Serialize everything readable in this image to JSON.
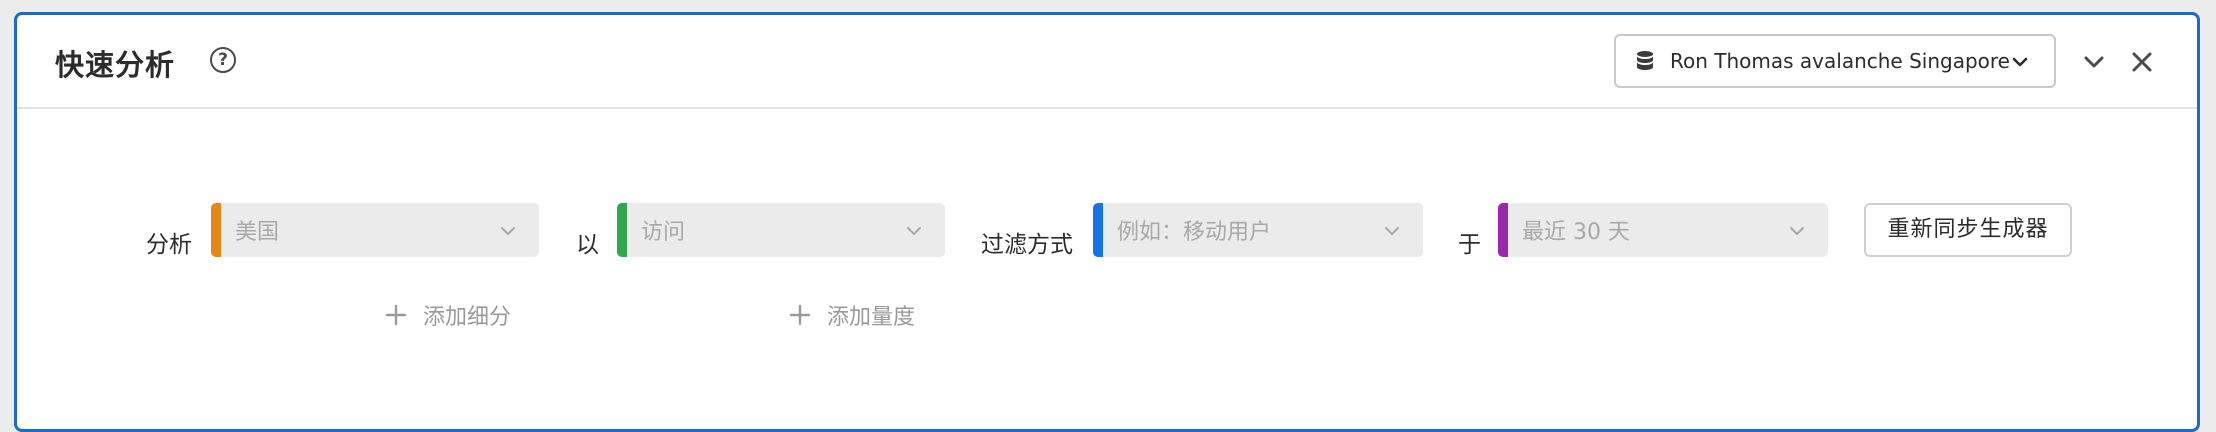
{
  "panel": {
    "title": "快速分析",
    "help_glyph": "?",
    "report_suite": "Ron Thomas avalanche Singapore"
  },
  "builder": {
    "dimension": {
      "label": "分析",
      "placeholder": "美国",
      "accent": "#e68619"
    },
    "metric": {
      "label": "以",
      "placeholder": "访问",
      "accent": "#2fa84f"
    },
    "segment": {
      "label": "过滤方式",
      "placeholder": "例如：移动用户",
      "accent": "#1473e6"
    },
    "date_range": {
      "label": "于",
      "placeholder": "最近 30 天",
      "accent": "#9c27b0"
    },
    "add_breakdown": "添加细分",
    "add_metric": "添加量度",
    "rebuild_button": "重新同步生成器"
  },
  "icons": {
    "help": "help-circle-icon",
    "database": "database-icon",
    "collapse": "chevron-down-icon",
    "close": "close-icon",
    "add": "plus-icon"
  }
}
